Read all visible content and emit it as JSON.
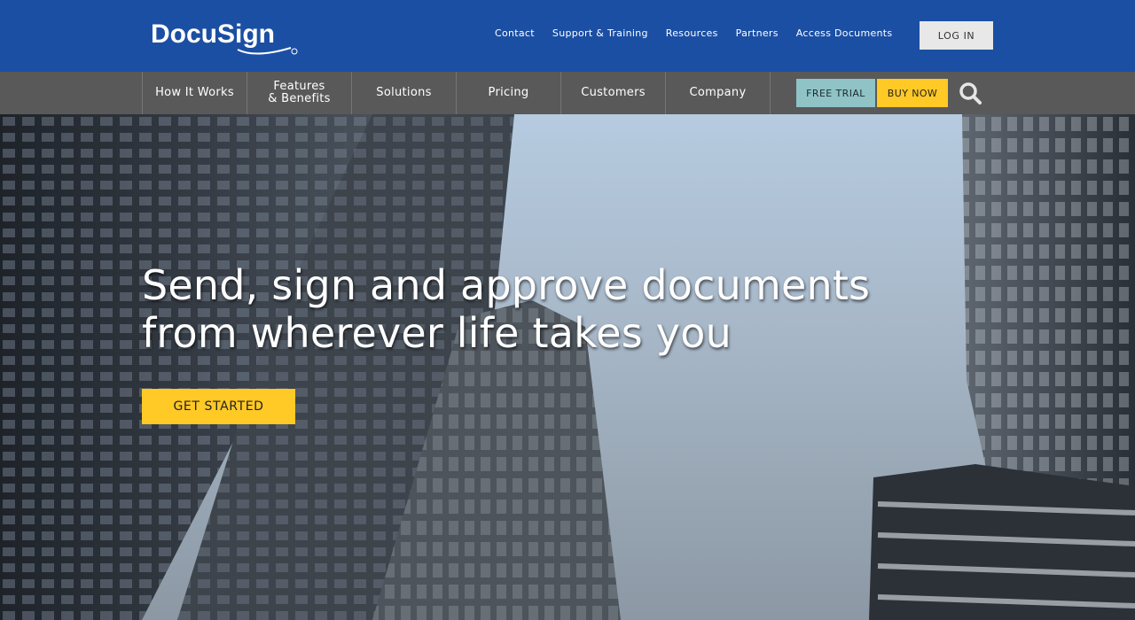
{
  "header": {
    "logo_text": "DocuSign",
    "top_links": [
      "Contact",
      "Support & Training",
      "Resources",
      "Partners",
      "Access Documents"
    ],
    "login_label": "LOG IN"
  },
  "nav": {
    "items": [
      {
        "label": "How It Works"
      },
      {
        "label": "Features\n& Benefits"
      },
      {
        "label": "Solutions"
      },
      {
        "label": "Pricing"
      },
      {
        "label": "Customers"
      },
      {
        "label": "Company"
      }
    ],
    "free_trial_label": "FREE TRIAL",
    "buy_now_label": "BUY NOW",
    "search_icon": "search-icon"
  },
  "hero": {
    "headline": "Send, sign and approve documents\nfrom wherever life takes you",
    "cta_label": "GET STARTED"
  },
  "colors": {
    "brand_blue": "#1b4fa3",
    "nav_gray": "#595959",
    "accent_yellow": "#ffc926",
    "trial_teal": "#8fc3c6"
  }
}
